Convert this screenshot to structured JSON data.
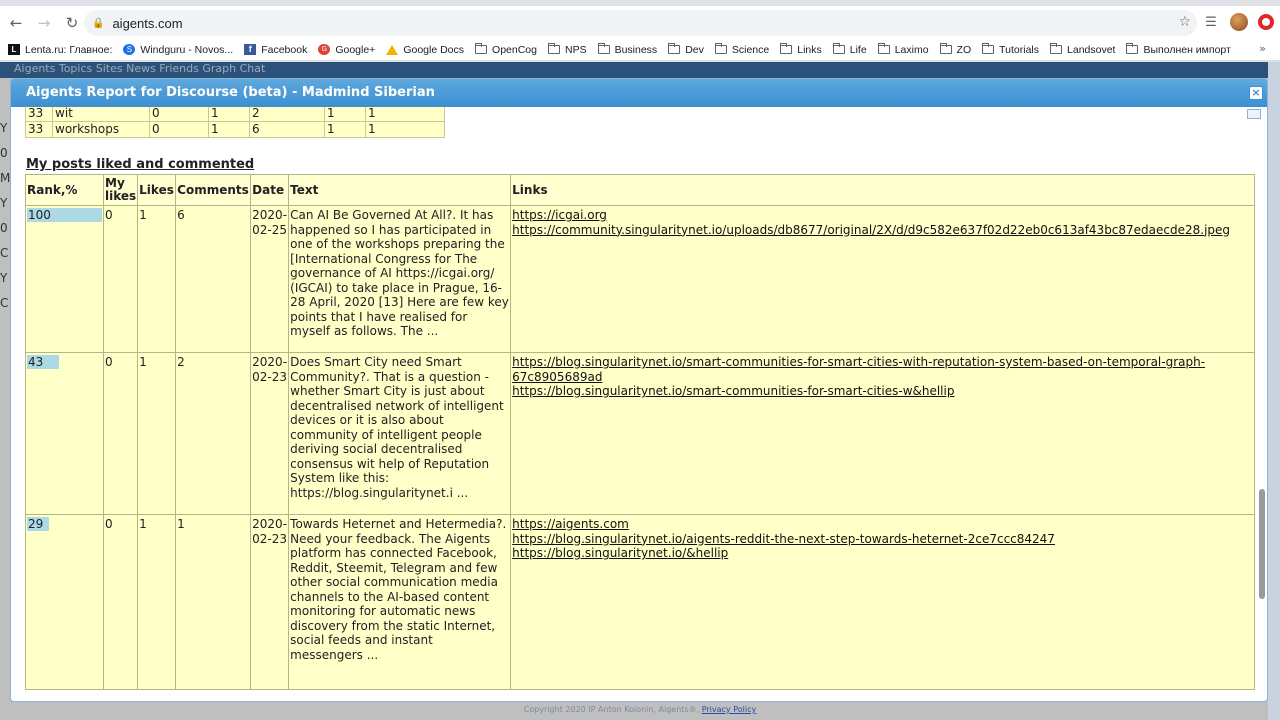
{
  "browser": {
    "url": "aigents.com",
    "bookmarks": [
      {
        "label": "Lenta.ru: Главное:",
        "icon": "lenta-icon"
      },
      {
        "label": "Windguru - Novos...",
        "icon": "windguru-icon"
      },
      {
        "label": "Facebook",
        "icon": "facebook-icon"
      },
      {
        "label": "Google+",
        "icon": "google-plus-icon"
      },
      {
        "label": "Google Docs",
        "icon": "google-docs-icon"
      },
      {
        "label": "OpenCog",
        "icon": "folder-icon"
      },
      {
        "label": "NPS",
        "icon": "folder-icon"
      },
      {
        "label": "Business",
        "icon": "folder-icon"
      },
      {
        "label": "Dev",
        "icon": "folder-icon"
      },
      {
        "label": "Science",
        "icon": "folder-icon"
      },
      {
        "label": "Links",
        "icon": "folder-icon"
      },
      {
        "label": "Life",
        "icon": "folder-icon"
      },
      {
        "label": "Laximo",
        "icon": "folder-icon"
      },
      {
        "label": "ZO",
        "icon": "folder-icon"
      },
      {
        "label": "Tutorials",
        "icon": "folder-icon"
      },
      {
        "label": "Landsovet",
        "icon": "folder-icon"
      },
      {
        "label": "Выполнен импорт",
        "icon": "folder-icon"
      }
    ],
    "more": "»"
  },
  "site_nav": "Aigents  Topics  Sites  News  Friends  Graph  Chat",
  "page_left_letters": [
    "Y",
    "0",
    "M",
    "Y",
    "0",
    "C",
    "Y",
    "C"
  ],
  "footer": {
    "copyright": "Copyright 2020 IP Anton Kolonin, Aigents®,",
    "privacy": "Privacy Policy"
  },
  "dialog": {
    "title": "Aigents Report for Discourse (beta) - Madmind Siberian",
    "close_label": "×",
    "top_rows": [
      {
        "rank": "33",
        "word": "wit",
        "c1": "0",
        "c2": "1",
        "c3": "2",
        "c4": "1",
        "c5": "1"
      },
      {
        "rank": "33",
        "word": "workshops",
        "c1": "0",
        "c2": "1",
        "c3": "6",
        "c4": "1",
        "c5": "1"
      }
    ],
    "section_title": "My posts liked and commented",
    "headers": {
      "rank": "Rank,%",
      "my_likes": "My likes",
      "likes": "Likes",
      "comments": "Comments",
      "date": "Date",
      "text": "Text",
      "links": "Links"
    },
    "rows": [
      {
        "rank": "100",
        "rank_pct": 100,
        "my_likes": "0",
        "likes": "1",
        "comments": "6",
        "date": "2020-02-25",
        "text": "Can AI Be Governed At All?. It has happened so I has participated in one of the workshops preparing the [International Congress for The governance of AI https://icgai.org/ (IGCAI) to take place in Prague, 16-28 April, 2020 [13] Here are few key points that I have realised for myself as follows. The ...",
        "links": [
          "https://icgai.org",
          "https://community.singularitynet.io/uploads/db8677/original/2X/d/d9c582e637f02d22eb0c613af43bc87edaecde28.jpeg"
        ]
      },
      {
        "rank": "43",
        "rank_pct": 43,
        "my_likes": "0",
        "likes": "1",
        "comments": "2",
        "date": "2020-02-23",
        "text": "Does Smart City need Smart Community?. That is a question - whether Smart City is just about decentralised network of intelligent devices or it is also about community of intelligent people deriving social decentralised consensus wit help of Reputation System like this: https://blog.singularitynet.i ...",
        "links": [
          "https://blog.singularitynet.io/smart-communities-for-smart-cities-with-reputation-system-based-on-temporal-graph-67c8905689ad",
          "https://blog.singularitynet.io/smart-communities-for-smart-cities-w&hellip"
        ]
      },
      {
        "rank": "29",
        "rank_pct": 29,
        "my_likes": "0",
        "likes": "1",
        "comments": "1",
        "date": "2020-02-23",
        "text": "Towards Heternet and Hetermedia?. Need your feedback. The Aigents platform has connected Facebook, Reddit, Steemit, Telegram and few other social communication media channels to the AI-based content monitoring for automatic news discovery from the static Internet, social feeds and instant messengers ...",
        "links": [
          "https://aigents.com",
          "https://blog.singularitynet.io/aigents-reddit-the-next-step-towards-heternet-2ce7ccc84247",
          "https://blog.singularitynet.io/&hellip"
        ]
      }
    ]
  }
}
